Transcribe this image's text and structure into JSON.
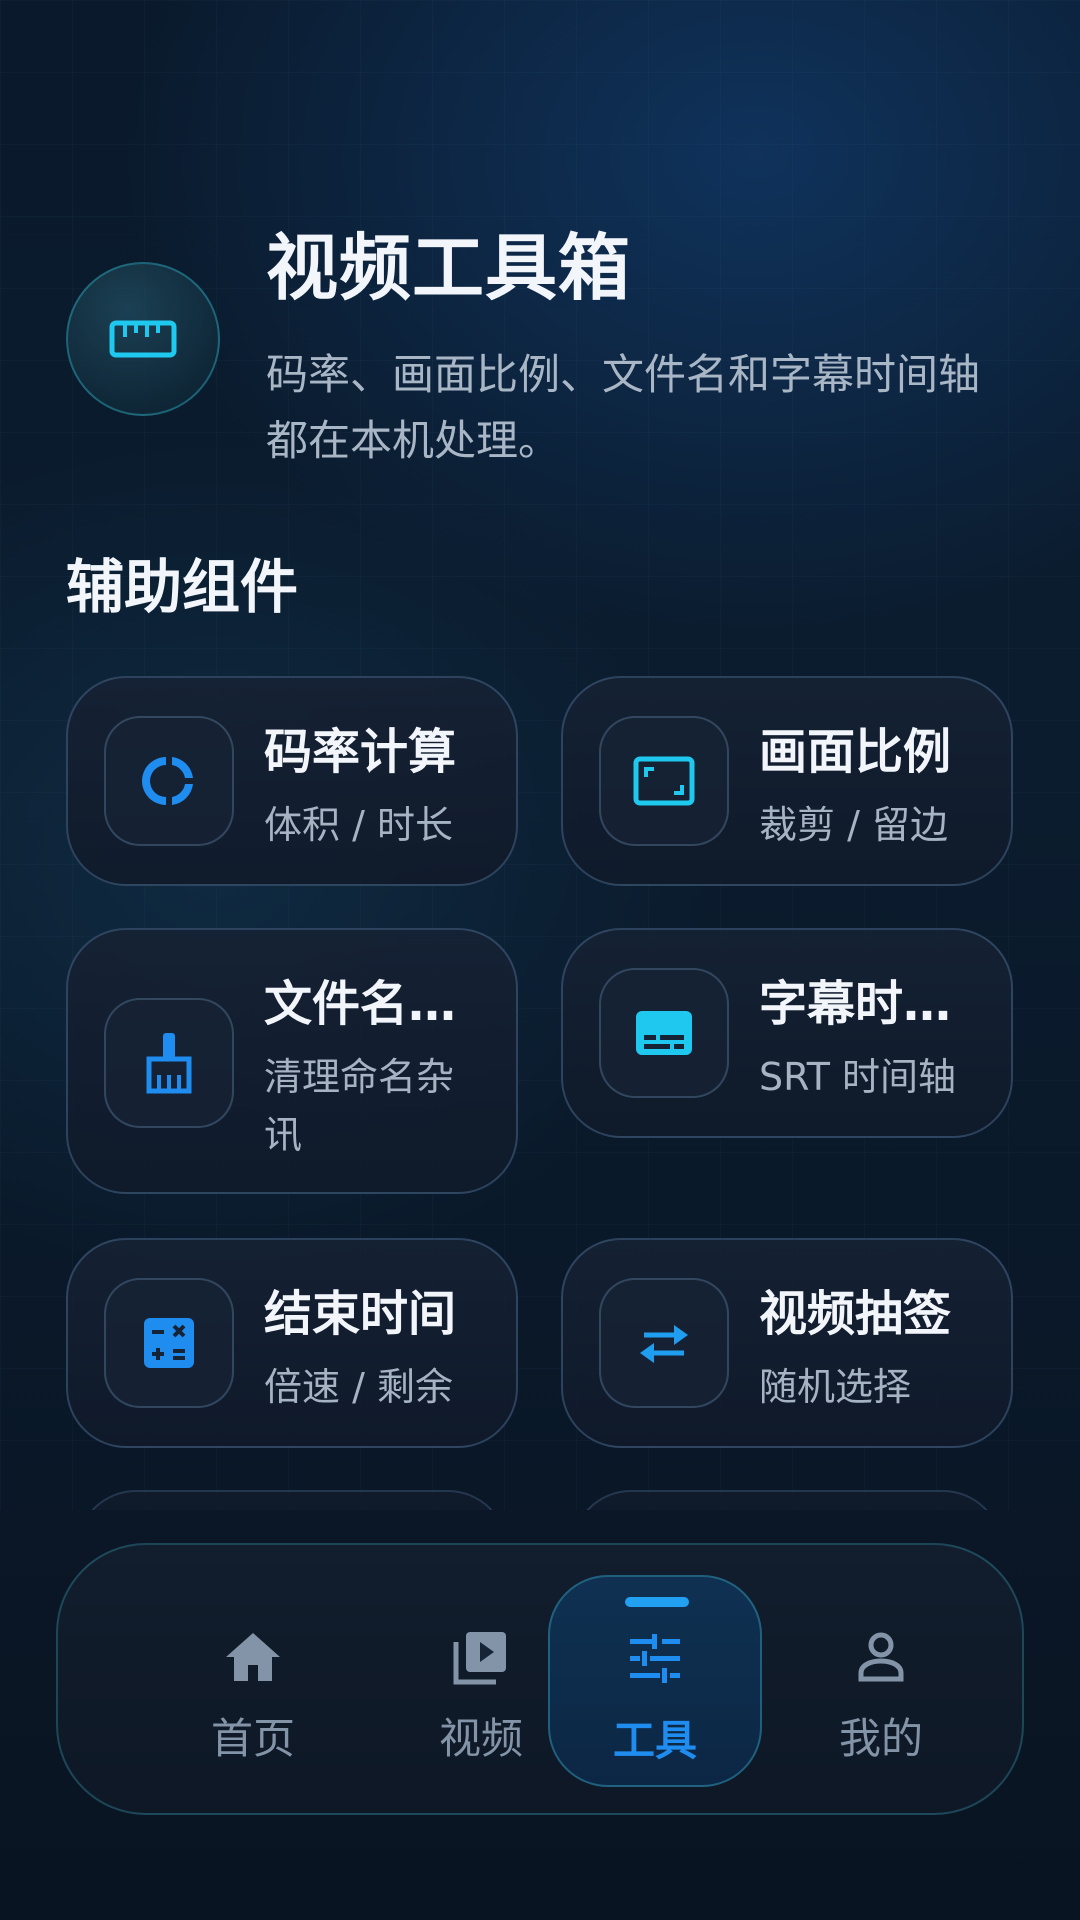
{
  "header": {
    "title": "视频工具箱",
    "subtitle": "码率、画面比例、文件名和字幕时间轴都在本机处理。",
    "icon": "ruler-icon"
  },
  "section": {
    "title": "辅助组件"
  },
  "cards": [
    {
      "title": "码率计算",
      "sub": "体积 / 时长",
      "icon": "donut-chart-icon"
    },
    {
      "title": "画面比例",
      "sub": "裁剪 / 留边",
      "icon": "aspect-ratio-icon"
    },
    {
      "title": "文件名清理",
      "sub": "清理命名杂讯",
      "icon": "cleaning-brush-icon"
    },
    {
      "title": "字幕时间轴",
      "sub": "SRT 时间轴",
      "icon": "subtitles-icon"
    },
    {
      "title": "结束时间",
      "sub": "倍速 / 剩余",
      "icon": "calculator-icon"
    },
    {
      "title": "视频抽签",
      "sub": "随机选择",
      "icon": "swap-arrows-icon"
    }
  ],
  "nav": {
    "items": [
      {
        "label": "首页",
        "icon": "home-icon"
      },
      {
        "label": "视频",
        "icon": "video-library-icon"
      },
      {
        "label": "工具",
        "icon": "sliders-icon",
        "active": true
      },
      {
        "label": "我的",
        "icon": "person-icon"
      }
    ]
  },
  "colors": {
    "accent": "#1f8cf0",
    "cyan": "#1fc8ee",
    "text_primary": "#f2f6fb",
    "text_secondary": "#a6b3c3"
  }
}
